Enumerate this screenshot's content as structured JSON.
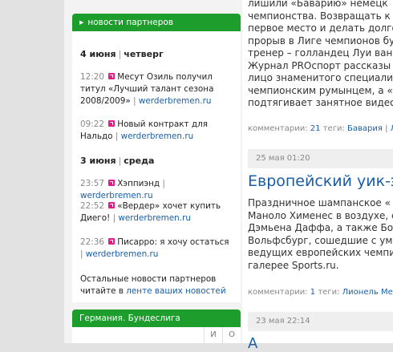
{
  "partner_news": {
    "title": "новости партнеров",
    "groups": [
      {
        "day": "4 июня",
        "weekday": "четверг",
        "items": [
          {
            "time": "12:20",
            "text": "Месут Озиль получил титул «Лучший талант сезона 2008/2009»",
            "source": "werderbremen.ru"
          },
          {
            "time": "09:22",
            "text": "Новый контракт для Нальдо",
            "source": "werderbremen.ru"
          }
        ]
      },
      {
        "day": "3 июня",
        "weekday": "среда",
        "items": [
          {
            "time": "23:57",
            "text": "Хэппиэнд",
            "source": "werderbremen.ru"
          },
          {
            "time": "22:52",
            "text": "«Вердер» хочет купить Диего!",
            "source": "werderbremen.ru"
          },
          {
            "time": "22:36",
            "text": "Писарро: я хочу остаться",
            "source": "werderbremen.ru"
          }
        ]
      }
    ],
    "footer_text": "Остальные новости партнеров читайте в",
    "footer_link": "ленте ваших новостей"
  },
  "league_widget": {
    "title": "Германия. Бундеслига",
    "columns": [
      "И",
      "О"
    ]
  },
  "main": {
    "article1_lines": [
      "лишили «Баварию» немецк",
      "чемпионства. Возвращать к",
      "первое место и делать долго",
      "прорыв в Лиге чемпионов бу",
      "тренер – голландец Луи ван",
      "Журнал PROспорт рассказы",
      "лицо знаменитого специали",
      "чемпионским румынцем, а «3",
      "подтягивает занятное видео"
    ],
    "article1_meta": {
      "comments_label": "комментарии:",
      "comments_count": "21",
      "tags_label": "теги:",
      "tag1": "Бавария",
      "tag2": "Лу"
    },
    "article2_date": "25 мая 01:20",
    "article2_title": "Европейский уик-э",
    "article2_lines": [
      "Праздничное шампанское «",
      "Маноло Хименес в воздухе, с",
      "Дэмьена Даффа, а также Бо",
      "Вольфсбург, сошедшие с ума",
      "ведущих европейских чемпи",
      "галерее Sports.ru."
    ],
    "article2_meta": {
      "comments_label": "комментарии:",
      "comments_count": "1",
      "tags_label": "теги:",
      "tag1": "Лионель Месси"
    },
    "article3_date": "23 мая 22:14",
    "article3_title_start": "А"
  }
}
